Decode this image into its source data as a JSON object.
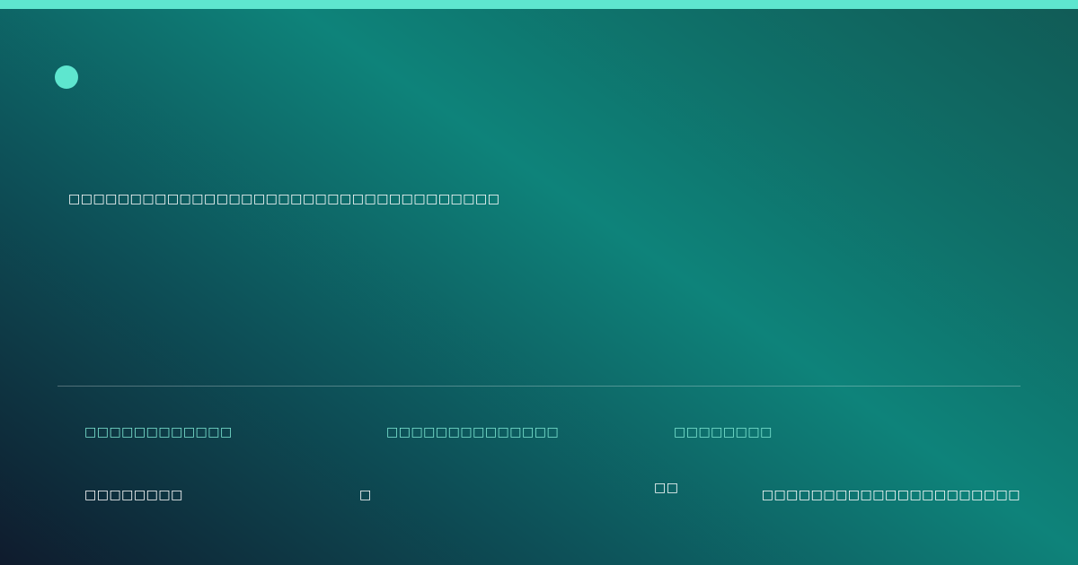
{
  "colors": {
    "accent": "#5ee6cf",
    "label": "#7ee8d4",
    "background_dark": "#0f1b2d",
    "background_teal": "#0e837a"
  },
  "logo": {
    "icon": "logo-dot-icon"
  },
  "headline": "□□□□□□□□□□□□□□□□□□□□□□□□□□□□□□□□□□□",
  "stats": [
    {
      "label": "□□□□□□□□□□□□",
      "value": "□□□□□□□□"
    },
    {
      "label": "□□□□□□□□□□□□□□",
      "value": "□"
    },
    {
      "label": "□□□□□□□□",
      "value": "□□"
    }
  ],
  "footer_note": "□□□□□□□□□□□□□□□□□□□□□"
}
